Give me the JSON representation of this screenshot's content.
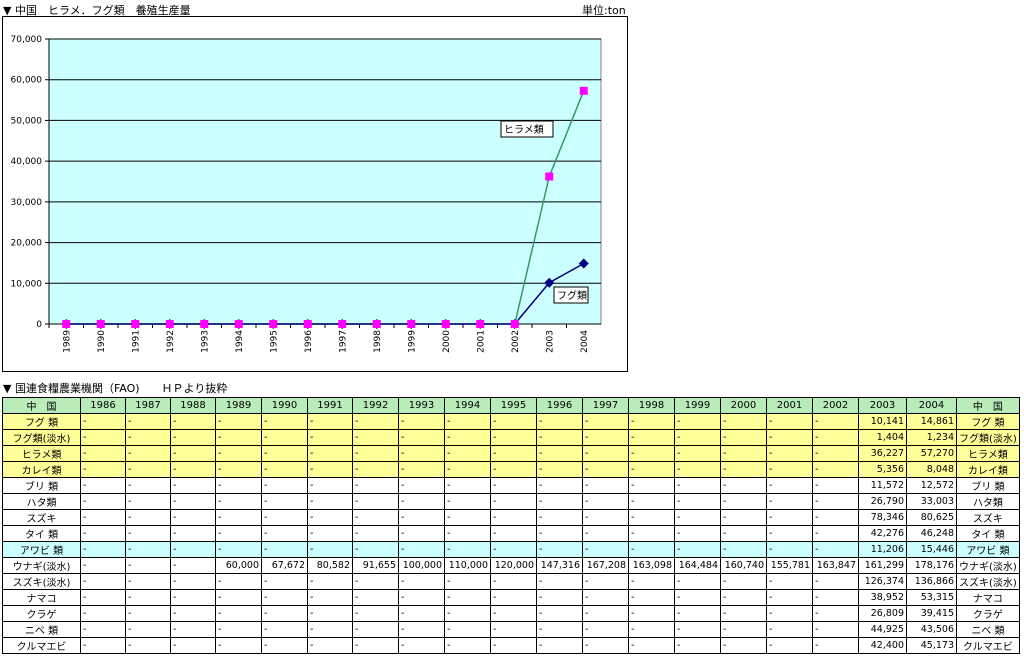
{
  "page": {
    "chart_title": "▼ 中国　ヒラメ．フグ類　養殖生産量",
    "unit": "単位:ton",
    "table_title": "▼ 国連食糧農業機関（FAO)　　ＨＰより抜粋"
  },
  "chart_data": {
    "type": "line",
    "x": [
      "1989",
      "1990",
      "1991",
      "1992",
      "1993",
      "1994",
      "1995",
      "1996",
      "1997",
      "1998",
      "1999",
      "2000",
      "2001",
      "2002",
      "2003",
      "2004"
    ],
    "ylim": [
      0,
      70000
    ],
    "yticks": [
      "0",
      "10,000",
      "20,000",
      "30,000",
      "40,000",
      "50,000",
      "60,000",
      "70,000"
    ],
    "grid": true,
    "plot_background": "#ccffff",
    "series": [
      {
        "name": "ヒラメ類",
        "color": "#ff00ff",
        "line_color": "#339966",
        "marker": "square",
        "values": [
          0,
          0,
          0,
          0,
          0,
          0,
          0,
          0,
          0,
          0,
          0,
          0,
          0,
          0,
          36227,
          57270
        ]
      },
      {
        "name": "フグ類",
        "color": "#000080",
        "line_color": "#000080",
        "marker": "diamond",
        "values": [
          0,
          0,
          0,
          0,
          0,
          0,
          0,
          0,
          0,
          0,
          0,
          0,
          0,
          0,
          10141,
          14861
        ]
      }
    ]
  },
  "table": {
    "corner_left": "中　国",
    "corner_right": "中　国",
    "years": [
      "1986",
      "1987",
      "1988",
      "1989",
      "1990",
      "1991",
      "1992",
      "1993",
      "1994",
      "1995",
      "1996",
      "1997",
      "1998",
      "1999",
      "2000",
      "2001",
      "2002",
      "2003",
      "2004"
    ],
    "rows": [
      {
        "name": "フグ 類",
        "hl": "yellow",
        "values": [
          "-",
          "-",
          "-",
          "-",
          "-",
          "-",
          "-",
          "-",
          "-",
          "-",
          "-",
          "-",
          "-",
          "-",
          "-",
          "-",
          "-",
          "10,141",
          "14,861"
        ]
      },
      {
        "name": "フグ類(淡水)",
        "hl": "yellow",
        "values": [
          "-",
          "-",
          "-",
          "-",
          "-",
          "-",
          "-",
          "-",
          "-",
          "-",
          "-",
          "-",
          "-",
          "-",
          "-",
          "-",
          "-",
          "1,404",
          "1,234"
        ]
      },
      {
        "name": "ヒラメ類",
        "hl": "yellow",
        "values": [
          "-",
          "-",
          "-",
          "-",
          "-",
          "-",
          "-",
          "-",
          "-",
          "-",
          "-",
          "-",
          "-",
          "-",
          "-",
          "-",
          "-",
          "36,227",
          "57,270"
        ]
      },
      {
        "name": "カレイ類",
        "hl": "yellow",
        "values": [
          "-",
          "-",
          "-",
          "-",
          "-",
          "-",
          "-",
          "-",
          "-",
          "-",
          "-",
          "-",
          "-",
          "-",
          "-",
          "-",
          "-",
          "5,356",
          "8,048"
        ]
      },
      {
        "name": "ブリ 類",
        "hl": "",
        "values": [
          "-",
          "-",
          "-",
          "-",
          "-",
          "-",
          "-",
          "-",
          "-",
          "-",
          "-",
          "-",
          "-",
          "-",
          "-",
          "-",
          "-",
          "11,572",
          "12,572"
        ]
      },
      {
        "name": "ハタ類",
        "hl": "",
        "values": [
          "-",
          "-",
          "-",
          "-",
          "-",
          "-",
          "-",
          "-",
          "-",
          "-",
          "-",
          "-",
          "-",
          "-",
          "-",
          "-",
          "-",
          "26,790",
          "33,003"
        ]
      },
      {
        "name": "スズキ",
        "hl": "",
        "values": [
          "-",
          "-",
          "-",
          "-",
          "-",
          "-",
          "-",
          "-",
          "-",
          "-",
          "-",
          "-",
          "-",
          "-",
          "-",
          "-",
          "-",
          "78,346",
          "80,625"
        ]
      },
      {
        "name": "タイ 類",
        "hl": "",
        "values": [
          "-",
          "-",
          "-",
          "-",
          "-",
          "-",
          "-",
          "-",
          "-",
          "-",
          "-",
          "-",
          "-",
          "-",
          "-",
          "-",
          "-",
          "42,276",
          "46,248"
        ]
      },
      {
        "name": "アワビ 類",
        "hl": "cyan",
        "values": [
          "-",
          "-",
          "-",
          "-",
          "-",
          "-",
          "-",
          "-",
          "-",
          "-",
          "-",
          "-",
          "-",
          "-",
          "-",
          "-",
          "-",
          "11,206",
          "15,446"
        ]
      },
      {
        "name": "ウナギ(淡水)",
        "hl": "",
        "values": [
          "-",
          "-",
          "-",
          "60,000",
          "67,672",
          "80,582",
          "91,655",
          "100,000",
          "110,000",
          "120,000",
          "147,316",
          "167,208",
          "163,098",
          "164,484",
          "160,740",
          "155,781",
          "163,847",
          "161,299",
          "178,176"
        ]
      },
      {
        "name": "スズキ(淡水)",
        "hl": "",
        "values": [
          "-",
          "-",
          "-",
          "-",
          "-",
          "-",
          "-",
          "-",
          "-",
          "-",
          "-",
          "-",
          "-",
          "-",
          "-",
          "-",
          "-",
          "126,374",
          "136,866"
        ]
      },
      {
        "name": "ナマコ",
        "hl": "",
        "values": [
          "-",
          "-",
          "-",
          "-",
          "-",
          "-",
          "-",
          "-",
          "-",
          "-",
          "-",
          "-",
          "-",
          "-",
          "-",
          "-",
          "-",
          "38,952",
          "53,315"
        ]
      },
      {
        "name": "クラゲ",
        "hl": "",
        "values": [
          "-",
          "-",
          "-",
          "-",
          "-",
          "-",
          "-",
          "-",
          "-",
          "-",
          "-",
          "-",
          "-",
          "-",
          "-",
          "-",
          "-",
          "26,809",
          "39,415"
        ]
      },
      {
        "name": "ニベ 類",
        "hl": "",
        "values": [
          "-",
          "-",
          "-",
          "-",
          "-",
          "-",
          "-",
          "-",
          "-",
          "-",
          "-",
          "-",
          "-",
          "-",
          "-",
          "-",
          "-",
          "44,925",
          "43,506"
        ]
      },
      {
        "name": "クルマエビ",
        "hl": "",
        "values": [
          "-",
          "-",
          "-",
          "-",
          "-",
          "-",
          "-",
          "-",
          "-",
          "-",
          "-",
          "-",
          "-",
          "-",
          "-",
          "-",
          "-",
          "42,400",
          "45,173"
        ]
      }
    ]
  }
}
